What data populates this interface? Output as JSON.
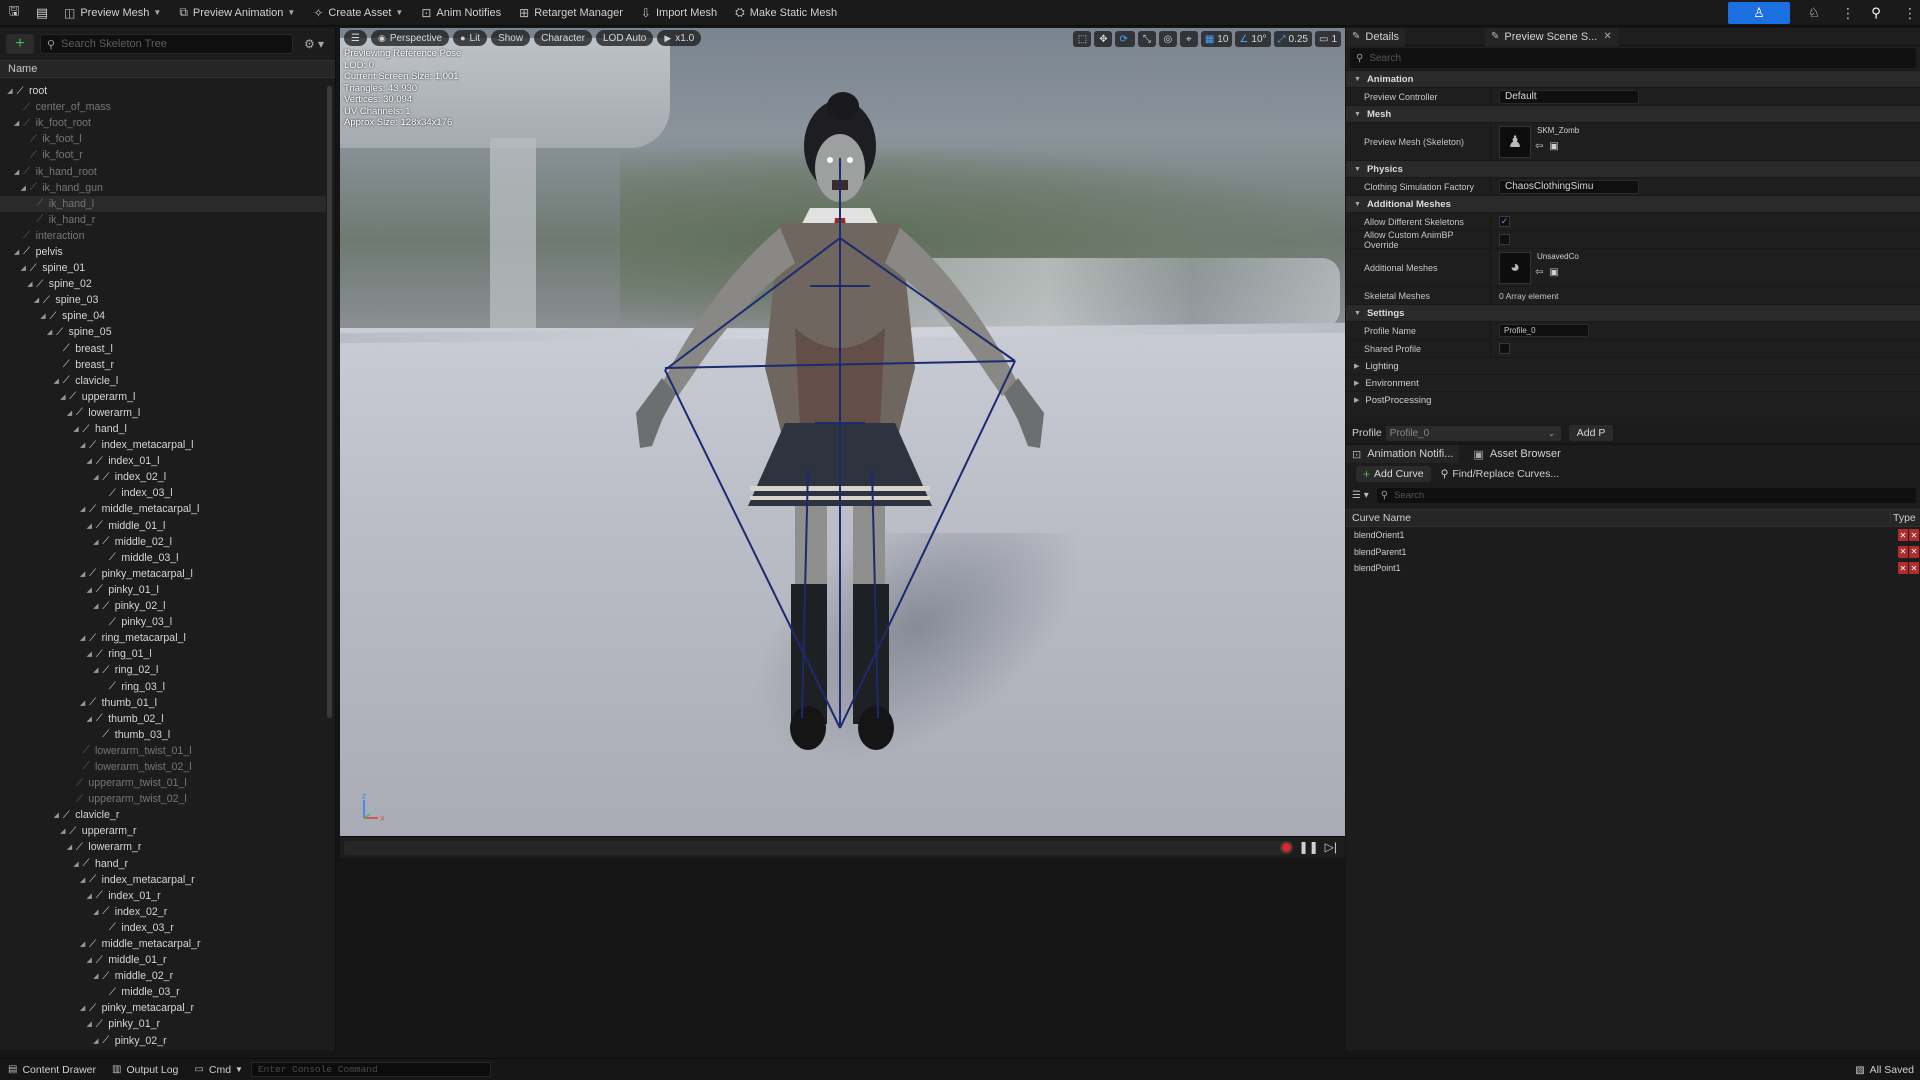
{
  "toolbar": {
    "save_icon": "save-icon",
    "browse_icon": "content-browser-icon",
    "preview_mesh": "Preview Mesh",
    "preview_animation": "Preview Animation",
    "create_asset": "Create Asset",
    "anim_notifies": "Anim Notifies",
    "retarget_manager": "Retarget Manager",
    "import_mesh": "Import Mesh",
    "make_static_mesh": "Make Static Mesh",
    "accent_color": "#1c6fe0"
  },
  "skeleton_tree": {
    "search_placeholder": "Search Skeleton Tree",
    "column_name": "Name",
    "bones": [
      {
        "name": "root",
        "depth": 0,
        "expanded": true,
        "dim": false
      },
      {
        "name": "center_of_mass",
        "depth": 1,
        "expanded": null,
        "dim": true
      },
      {
        "name": "ik_foot_root",
        "depth": 1,
        "expanded": true,
        "dim": true
      },
      {
        "name": "ik_foot_l",
        "depth": 2,
        "expanded": null,
        "dim": true
      },
      {
        "name": "ik_foot_r",
        "depth": 2,
        "expanded": null,
        "dim": true
      },
      {
        "name": "ik_hand_root",
        "depth": 1,
        "expanded": true,
        "dim": true
      },
      {
        "name": "ik_hand_gun",
        "depth": 2,
        "expanded": true,
        "dim": true
      },
      {
        "name": "ik_hand_l",
        "depth": 3,
        "expanded": null,
        "dim": true,
        "selected": true
      },
      {
        "name": "ik_hand_r",
        "depth": 3,
        "expanded": null,
        "dim": true
      },
      {
        "name": "interaction",
        "depth": 1,
        "expanded": null,
        "dim": true
      },
      {
        "name": "pelvis",
        "depth": 1,
        "expanded": true,
        "dim": false
      },
      {
        "name": "spine_01",
        "depth": 2,
        "expanded": true,
        "dim": false
      },
      {
        "name": "spine_02",
        "depth": 3,
        "expanded": true,
        "dim": false
      },
      {
        "name": "spine_03",
        "depth": 4,
        "expanded": true,
        "dim": false
      },
      {
        "name": "spine_04",
        "depth": 5,
        "expanded": true,
        "dim": false
      },
      {
        "name": "spine_05",
        "depth": 6,
        "expanded": true,
        "dim": false
      },
      {
        "name": "breast_l",
        "depth": 7,
        "expanded": null,
        "dim": false
      },
      {
        "name": "breast_r",
        "depth": 7,
        "expanded": null,
        "dim": false
      },
      {
        "name": "clavicle_l",
        "depth": 7,
        "expanded": true,
        "dim": false
      },
      {
        "name": "upperarm_l",
        "depth": 8,
        "expanded": true,
        "dim": false
      },
      {
        "name": "lowerarm_l",
        "depth": 9,
        "expanded": true,
        "dim": false
      },
      {
        "name": "hand_l",
        "depth": 10,
        "expanded": true,
        "dim": false
      },
      {
        "name": "index_metacarpal_l",
        "depth": 11,
        "expanded": true,
        "dim": false
      },
      {
        "name": "index_01_l",
        "depth": 12,
        "expanded": true,
        "dim": false
      },
      {
        "name": "index_02_l",
        "depth": 13,
        "expanded": true,
        "dim": false
      },
      {
        "name": "index_03_l",
        "depth": 14,
        "expanded": null,
        "dim": false
      },
      {
        "name": "middle_metacarpal_l",
        "depth": 11,
        "expanded": true,
        "dim": false
      },
      {
        "name": "middle_01_l",
        "depth": 12,
        "expanded": true,
        "dim": false
      },
      {
        "name": "middle_02_l",
        "depth": 13,
        "expanded": true,
        "dim": false
      },
      {
        "name": "middle_03_l",
        "depth": 14,
        "expanded": null,
        "dim": false
      },
      {
        "name": "pinky_metacarpal_l",
        "depth": 11,
        "expanded": true,
        "dim": false
      },
      {
        "name": "pinky_01_l",
        "depth": 12,
        "expanded": true,
        "dim": false
      },
      {
        "name": "pinky_02_l",
        "depth": 13,
        "expanded": true,
        "dim": false
      },
      {
        "name": "pinky_03_l",
        "depth": 14,
        "expanded": null,
        "dim": false
      },
      {
        "name": "ring_metacarpal_l",
        "depth": 11,
        "expanded": true,
        "dim": false
      },
      {
        "name": "ring_01_l",
        "depth": 12,
        "expanded": true,
        "dim": false
      },
      {
        "name": "ring_02_l",
        "depth": 13,
        "expanded": true,
        "dim": false
      },
      {
        "name": "ring_03_l",
        "depth": 14,
        "expanded": null,
        "dim": false
      },
      {
        "name": "thumb_01_l",
        "depth": 11,
        "expanded": true,
        "dim": false
      },
      {
        "name": "thumb_02_l",
        "depth": 12,
        "expanded": true,
        "dim": false
      },
      {
        "name": "thumb_03_l",
        "depth": 13,
        "expanded": null,
        "dim": false
      },
      {
        "name": "lowerarm_twist_01_l",
        "depth": 10,
        "expanded": null,
        "dim": true
      },
      {
        "name": "lowerarm_twist_02_l",
        "depth": 10,
        "expanded": null,
        "dim": true
      },
      {
        "name": "upperarm_twist_01_l",
        "depth": 9,
        "expanded": null,
        "dim": true
      },
      {
        "name": "upperarm_twist_02_l",
        "depth": 9,
        "expanded": null,
        "dim": true
      },
      {
        "name": "clavicle_r",
        "depth": 7,
        "expanded": true,
        "dim": false
      },
      {
        "name": "upperarm_r",
        "depth": 8,
        "expanded": true,
        "dim": false
      },
      {
        "name": "lowerarm_r",
        "depth": 9,
        "expanded": true,
        "dim": false
      },
      {
        "name": "hand_r",
        "depth": 10,
        "expanded": true,
        "dim": false
      },
      {
        "name": "index_metacarpal_r",
        "depth": 11,
        "expanded": true,
        "dim": false
      },
      {
        "name": "index_01_r",
        "depth": 12,
        "expanded": true,
        "dim": false
      },
      {
        "name": "index_02_r",
        "depth": 13,
        "expanded": true,
        "dim": false
      },
      {
        "name": "index_03_r",
        "depth": 14,
        "expanded": null,
        "dim": false
      },
      {
        "name": "middle_metacarpal_r",
        "depth": 11,
        "expanded": true,
        "dim": false
      },
      {
        "name": "middle_01_r",
        "depth": 12,
        "expanded": true,
        "dim": false
      },
      {
        "name": "middle_02_r",
        "depth": 13,
        "expanded": true,
        "dim": false
      },
      {
        "name": "middle_03_r",
        "depth": 14,
        "expanded": null,
        "dim": false
      },
      {
        "name": "pinky_metacarpal_r",
        "depth": 11,
        "expanded": true,
        "dim": false
      },
      {
        "name": "pinky_01_r",
        "depth": 12,
        "expanded": true,
        "dim": false
      },
      {
        "name": "pinky_02_r",
        "depth": 13,
        "expanded": true,
        "dim": false
      }
    ]
  },
  "viewport": {
    "perspective": "Perspective",
    "lit": "Lit",
    "show": "Show",
    "character": "Character",
    "lod": "LOD Auto",
    "play_rate": "x1.0",
    "grid_value": "10",
    "angle_snap": "10°",
    "scale_snap": "0.25",
    "camera_speed": "1",
    "stats": [
      "Previewing Reference Pose",
      "LOD: 0",
      "Current Screen Size: 1.001",
      "Triangles: 43,930",
      "Vertices: 30,094",
      "UV Channels: 1",
      "Approx Size: 128x34x176"
    ]
  },
  "details": {
    "tab_details": "Details",
    "tab_preview_scene": "Preview Scene S...",
    "search_placeholder": "Search",
    "cat_animation": "Animation",
    "preview_controller_label": "Preview Controller",
    "preview_controller_value": "Default",
    "cat_mesh": "Mesh",
    "preview_mesh_label": "Preview Mesh (Skeleton)",
    "preview_mesh_value": "SKM_Zomb",
    "cat_physics": "Physics",
    "clothing_factory_label": "Clothing Simulation Factory",
    "clothing_factory_value": "ChaosClothingSimu",
    "cat_additional_meshes": "Additional Meshes",
    "allow_different_skeletons_label": "Allow Different Skeletons",
    "allow_different_skeletons_checked": true,
    "allow_custom_animbp_label": "Allow Custom AnimBP Override",
    "allow_custom_animbp_checked": false,
    "additional_meshes_label": "Additional Meshes",
    "additional_meshes_value": "UnsavedCo",
    "skeletal_meshes_label": "Skeletal Meshes",
    "skeletal_meshes_value": "0 Array element",
    "cat_settings": "Settings",
    "profile_name_label": "Profile Name",
    "profile_name_value": "Profile_0",
    "shared_profile_label": "Shared Profile",
    "shared_profile_checked": false,
    "cat_lighting": "Lighting",
    "cat_environment": "Environment",
    "cat_postprocessing": "PostProcessing"
  },
  "profile": {
    "label": "Profile",
    "value": "Profile_0",
    "add_button": "Add P"
  },
  "curves": {
    "tab_anim_notifies": "Animation Notifi...",
    "tab_asset_browser": "Asset Browser",
    "add_curve": "Add Curve",
    "find_replace": "Find/Replace Curves...",
    "search_placeholder": "Search",
    "col_name": "Curve Name",
    "col_type": "Type",
    "rows": [
      "blendOrient1",
      "blendParent1",
      "blendPoint1"
    ]
  },
  "statusbar": {
    "content_drawer": "Content Drawer",
    "output_log": "Output Log",
    "cmd": "Cmd",
    "console_placeholder": "Enter Console Command",
    "all_saved": "All Saved"
  }
}
